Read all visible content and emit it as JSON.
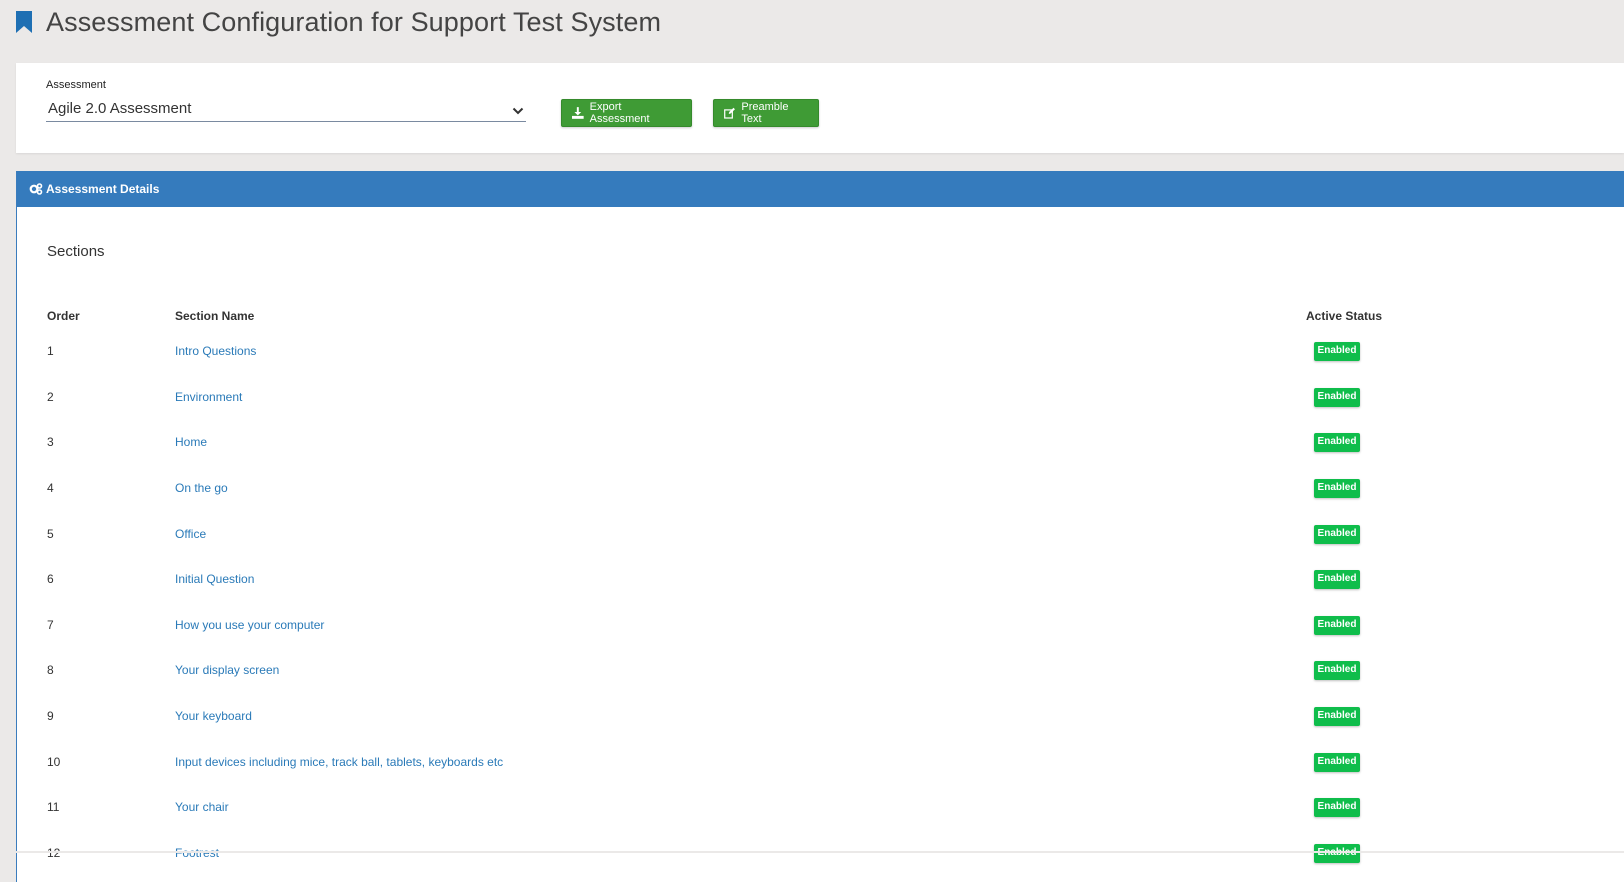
{
  "page": {
    "title": "Assessment Configuration for Support Test System"
  },
  "assessment_select": {
    "label": "Assessment",
    "value": "Agile 2.0 Assessment"
  },
  "buttons": {
    "export": "Export Assessment",
    "preamble": "Preamble Text"
  },
  "details": {
    "header": "Assessment Details",
    "sections_title": "Sections",
    "columns": {
      "order": "Order",
      "name": "Section Name",
      "status": "Active Status"
    },
    "rows": [
      {
        "order": "1",
        "name": "Intro Questions",
        "status": "Enabled"
      },
      {
        "order": "2",
        "name": "Environment",
        "status": "Enabled"
      },
      {
        "order": "3",
        "name": "Home",
        "status": "Enabled"
      },
      {
        "order": "4",
        "name": "On the go",
        "status": "Enabled"
      },
      {
        "order": "5",
        "name": "Office",
        "status": "Enabled"
      },
      {
        "order": "6",
        "name": "Initial Question",
        "status": "Enabled"
      },
      {
        "order": "7",
        "name": "How you use your computer",
        "status": "Enabled"
      },
      {
        "order": "8",
        "name": "Your display screen",
        "status": "Enabled"
      },
      {
        "order": "9",
        "name": "Your keyboard",
        "status": "Enabled"
      },
      {
        "order": "10",
        "name": "Input devices including mice, track ball, tablets, keyboards etc",
        "status": "Enabled"
      },
      {
        "order": "11",
        "name": "Your chair",
        "status": "Enabled"
      },
      {
        "order": "12",
        "name": "Footrest",
        "status": "Enabled"
      }
    ]
  },
  "colors": {
    "background": "#ebe9e8",
    "header_blue": "#357bbd",
    "button_green": "#3f9b35",
    "badge_green": "#0fbd4b",
    "link_blue": "#2a7ab8",
    "bookmark_blue": "#1e6fb3"
  },
  "icons": {
    "title": "bookmark-icon",
    "select": "chevron-down-icon",
    "export": "download-icon",
    "preamble": "edit-icon",
    "details": "cogs-icon"
  }
}
